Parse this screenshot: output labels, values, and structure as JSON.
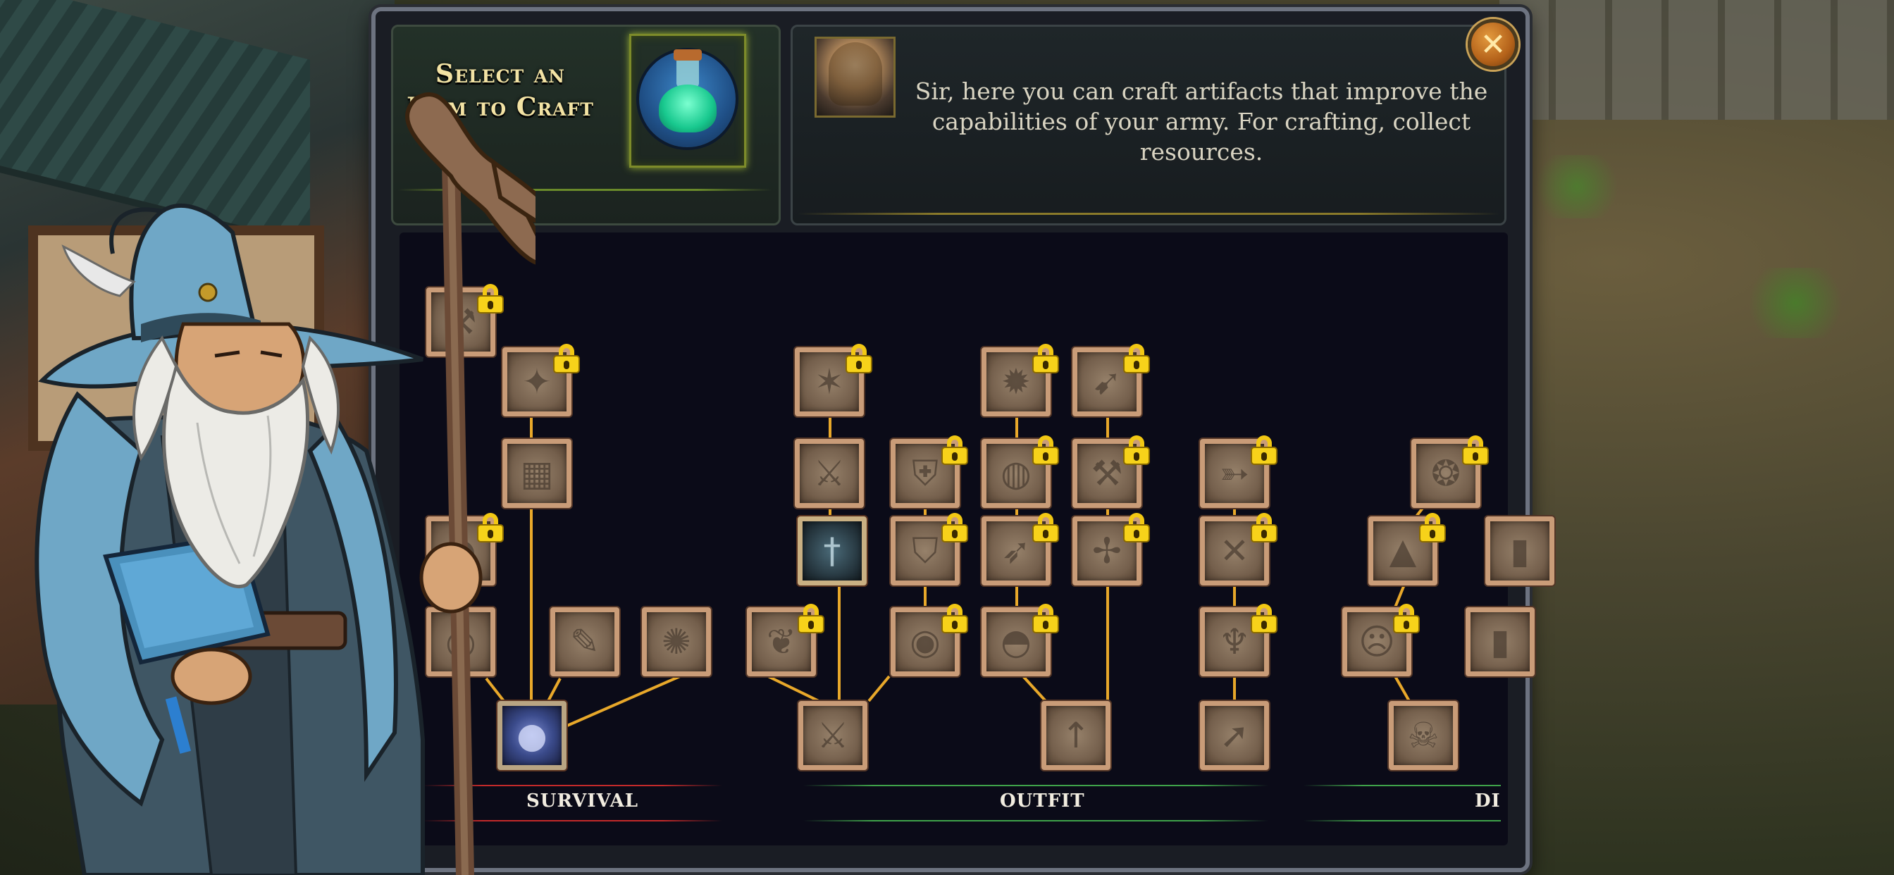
{
  "header": {
    "title": "Select an Item to Craft",
    "close_icon": "close-x-icon"
  },
  "dialog": {
    "text": "Sir, here you can craft artifacts that improve the capabilities of your army. For crafting, collect resources."
  },
  "categories": [
    {
      "label": "SURVIVAL",
      "color": "#c42a2a"
    },
    {
      "label": "OUTFIT",
      "color": "#3fa34a"
    },
    {
      "label": "DI",
      "color": "#3fa34a"
    }
  ],
  "colors": {
    "tree_line": "#e8a82a",
    "lock": "#f7d21a",
    "node_frame": "#d59a6a",
    "panel_bg": "#1a1d24"
  },
  "tree": {
    "nodes": [
      {
        "id": "s1",
        "icon": "mace-icon",
        "locked": true
      },
      {
        "id": "s2",
        "icon": "crossbow-icon",
        "locked": true
      },
      {
        "id": "s3",
        "icon": "chest-icon",
        "locked": false
      },
      {
        "id": "s4",
        "icon": "horn-icon",
        "locked": true
      },
      {
        "id": "s5",
        "icon": "scroll-icon",
        "locked": false
      },
      {
        "id": "s6",
        "icon": "feather-wing-icon",
        "locked": false
      },
      {
        "id": "s7",
        "icon": "sun-wheel-icon",
        "locked": false
      },
      {
        "id": "s8",
        "icon": "blue-orb-icon",
        "locked": false,
        "active": true
      },
      {
        "id": "o1",
        "icon": "leaf-bundle-icon",
        "locked": true
      },
      {
        "id": "o2",
        "icon": "shuriken-icon",
        "locked": true
      },
      {
        "id": "o3",
        "icon": "crossed-swords-icon",
        "locked": false
      },
      {
        "id": "o4",
        "icon": "dagger-icon",
        "locked": false,
        "active": true
      },
      {
        "id": "o5",
        "icon": "sword-icon",
        "locked": false
      },
      {
        "id": "o6",
        "icon": "shield-icon",
        "locked": true
      },
      {
        "id": "o7",
        "icon": "kite-shield-icon",
        "locked": true
      },
      {
        "id": "o8",
        "icon": "round-shield-icon",
        "locked": true
      },
      {
        "id": "o9",
        "icon": "fire-burst-icon",
        "locked": true
      },
      {
        "id": "o10",
        "icon": "amulet-icon",
        "locked": true
      },
      {
        "id": "o11",
        "icon": "bow-icon",
        "locked": true
      },
      {
        "id": "o12",
        "icon": "helmet-icon",
        "locked": true
      },
      {
        "id": "o13",
        "icon": "arrow-bundle-icon",
        "locked": true
      },
      {
        "id": "o14",
        "icon": "axe-icon",
        "locked": true
      },
      {
        "id": "o15",
        "icon": "halberd-icon",
        "locked": true
      },
      {
        "id": "o16",
        "icon": "spear-icon",
        "locked": false
      },
      {
        "id": "o17",
        "icon": "arrows-icon",
        "locked": true
      },
      {
        "id": "o18",
        "icon": "crossed-staff-icon",
        "locked": true
      },
      {
        "id": "o19",
        "icon": "quiver-icon",
        "locked": true
      },
      {
        "id": "o20",
        "icon": "arrow-spread-icon",
        "locked": false
      },
      {
        "id": "d1",
        "icon": "red-amulet-icon",
        "locked": true
      },
      {
        "id": "d2",
        "icon": "tent-icon",
        "locked": true
      },
      {
        "id": "d3",
        "icon": "stone-face-icon",
        "locked": true
      },
      {
        "id": "d4",
        "icon": "skull-icon",
        "locked": false
      },
      {
        "id": "d5",
        "icon": "partial-icon",
        "locked": false
      },
      {
        "id": "d6",
        "icon": "partial-icon",
        "locked": false
      }
    ]
  }
}
